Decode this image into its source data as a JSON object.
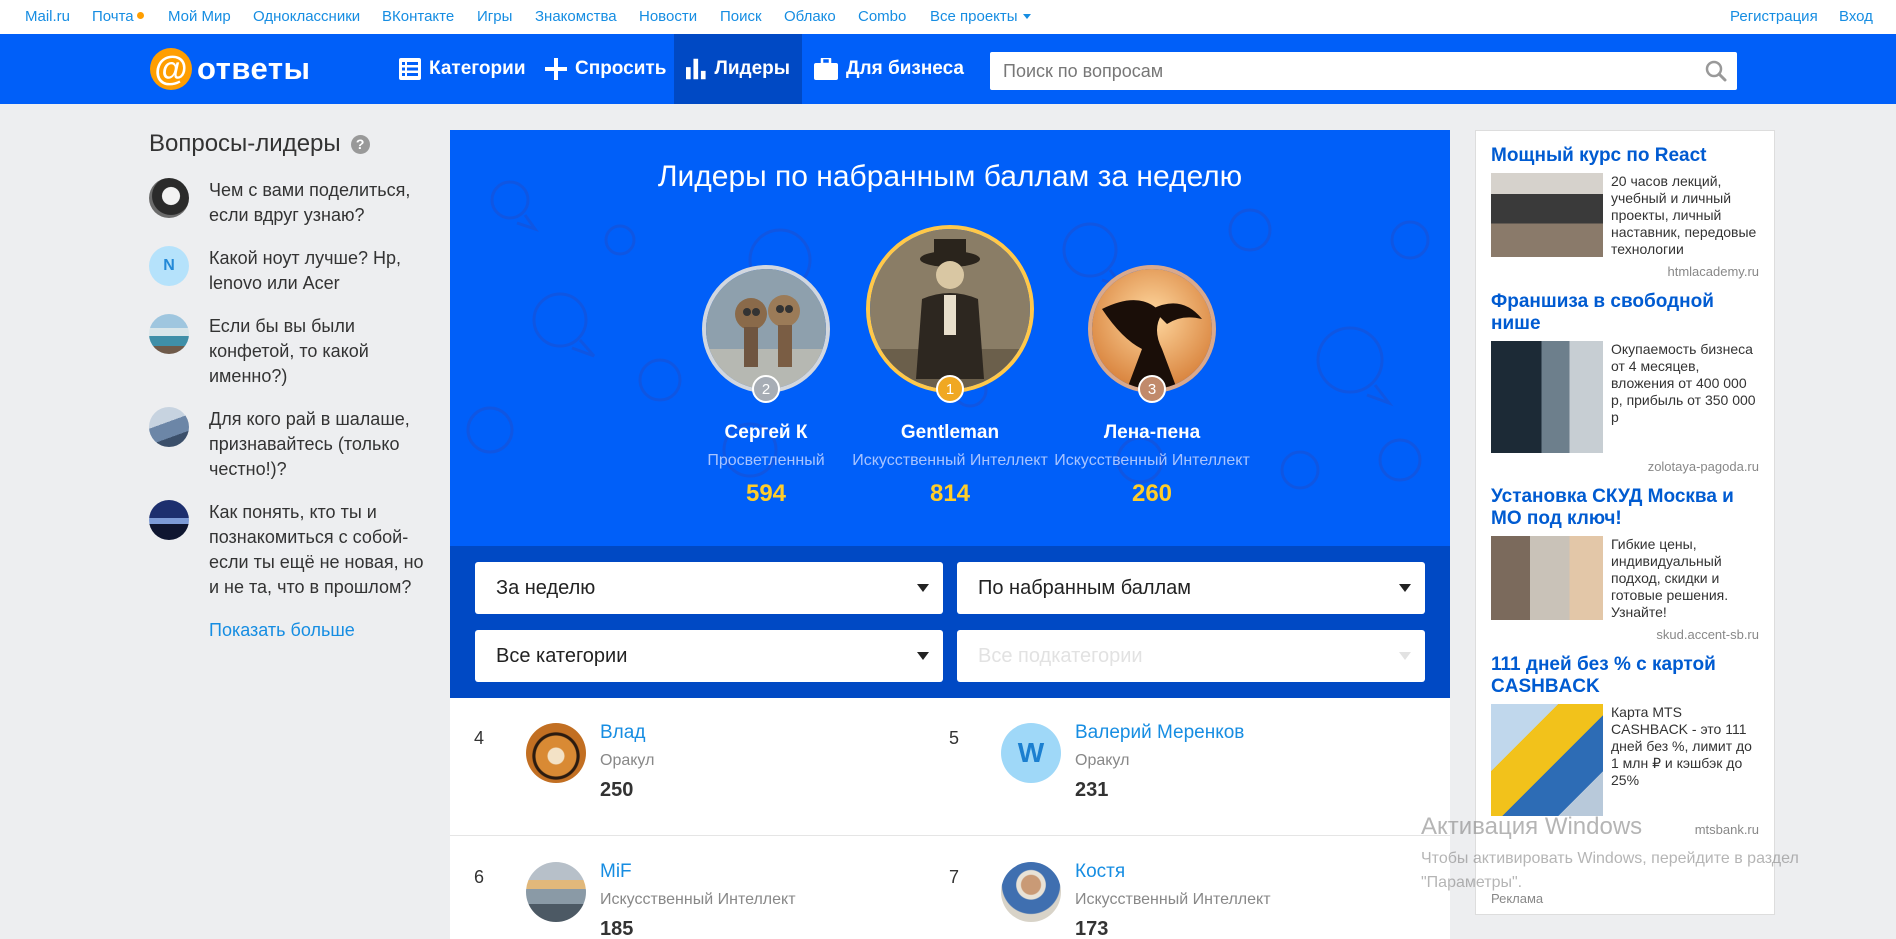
{
  "portal": {
    "links": [
      {
        "label": "Mail.ru",
        "name": "portal-link-mailru"
      },
      {
        "label": "Почта",
        "name": "portal-link-pochta",
        "dot": true
      },
      {
        "label": "Мой Мир",
        "name": "portal-link-moy-mir"
      },
      {
        "label": "Одноклассники",
        "name": "portal-link-odnoklassniki"
      },
      {
        "label": "ВКонтакте",
        "name": "portal-link-vkontakte"
      },
      {
        "label": "Игры",
        "name": "portal-link-igry"
      },
      {
        "label": "Знакомства",
        "name": "portal-link-znakomstva"
      },
      {
        "label": "Новости",
        "name": "portal-link-novosti"
      },
      {
        "label": "Поиск",
        "name": "portal-link-poisk"
      },
      {
        "label": "Облако",
        "name": "portal-link-oblako"
      },
      {
        "label": "Combo",
        "name": "portal-link-combo"
      },
      {
        "label": "Все проекты",
        "name": "portal-link-all-projects",
        "caret": true
      }
    ],
    "register": "Регистрация",
    "login": "Вход"
  },
  "header": {
    "logo_text": "ответы",
    "nav": [
      {
        "label": "Категории",
        "icon": "list-icon",
        "active": false
      },
      {
        "label": "Спросить",
        "icon": "plus-icon",
        "active": false
      },
      {
        "label": "Лидеры",
        "icon": "bar-chart-icon",
        "active": true
      },
      {
        "label": "Для бизнеса",
        "icon": "briefcase-icon",
        "active": false
      }
    ],
    "search_placeholder": "Поиск по вопросам"
  },
  "left": {
    "title": "Вопросы-лидеры",
    "help": "?",
    "questions": [
      {
        "text": "Чем с вами поделиться, если вдруг узнаю?",
        "avatar": "photo"
      },
      {
        "text": "Какой ноут лучше? Hp, lenovo или Acer",
        "avatar": "letter",
        "letter": "N"
      },
      {
        "text": "Если бы вы были конфетой, то какой именно?)",
        "avatar": "photo"
      },
      {
        "text": "Для кого рай в шалаше, признавайтесь (только честно!)?",
        "avatar": "photo"
      },
      {
        "text": "Как понять, кто ты и познакомиться с собой- если ты ещё не новая, но и не та, что в прошлом?",
        "avatar": "photo"
      }
    ],
    "more": "Показать больше"
  },
  "main": {
    "hero_title": "Лидеры по набранным баллам за неделю",
    "top": [
      {
        "place": "2",
        "name": "Сергей К",
        "rank": "Просветленный",
        "points": "594",
        "ring_color": "#d2d7df"
      },
      {
        "place": "1",
        "name": "Gentleman",
        "rank": "Искусственный Интеллект",
        "points": "814",
        "ring_color": "#ffc84a"
      },
      {
        "place": "3",
        "name": "Лена-пена",
        "rank": "Искусственный Интеллект",
        "points": "260",
        "ring_color": "#d9a98d"
      }
    ],
    "filters": {
      "period": "За неделю",
      "sort": "По набранным баллам",
      "category": "Все категории",
      "subcategory": "Все подкатегории"
    },
    "list": [
      {
        "place": "4",
        "name": "Влад",
        "rank": "Оракул",
        "points": "250"
      },
      {
        "place": "5",
        "name": "Валерий Меренков",
        "rank": "Оракул",
        "points": "231",
        "letter": "W"
      },
      {
        "place": "6",
        "name": "MiF",
        "rank": "Искусственный Интеллект",
        "points": "185"
      },
      {
        "place": "7",
        "name": "Костя",
        "rank": "Искусственный Интеллект",
        "points": "173"
      }
    ]
  },
  "ads": {
    "items": [
      {
        "title": "Мощный курс по React",
        "desc": "20 часов лекций, учебный и личный проекты, личный наставник, передовые технологии",
        "domain": "htmlacademy.ru"
      },
      {
        "title": "Франшиза в свободной нише",
        "desc": "Окупаемость бизнеса от 4 месяцев, вложения от 400 000 р, прибыль от 350 000 р",
        "domain": "zolotaya-pagoda.ru"
      },
      {
        "title": "Установка СКУД Москва и МО под ключ!",
        "desc": "Гибкие цены, индивидуальный подход, скидки и готовые решения. Узнайте!",
        "domain": "skud.accent-sb.ru"
      },
      {
        "title": "111 дней без % с картой CASHBACK",
        "desc": "Карта MTS CASHBACK - это 111 дней без %, лимит до 1 млн ₽ и кэшбэк до 25%",
        "domain": "mtsbank.ru"
      }
    ],
    "label": "Реклама"
  },
  "watermark": {
    "title": "Активация Windows",
    "text": "Чтобы активировать Windows, перейдите в раздел \"Параметры\"."
  },
  "colors": {
    "brand_blue": "#005ff9",
    "dark_blue": "#0049c4",
    "link_blue": "#168de2",
    "accent_orange": "#ff9e00",
    "points_yellow": "#ffcd2a"
  }
}
